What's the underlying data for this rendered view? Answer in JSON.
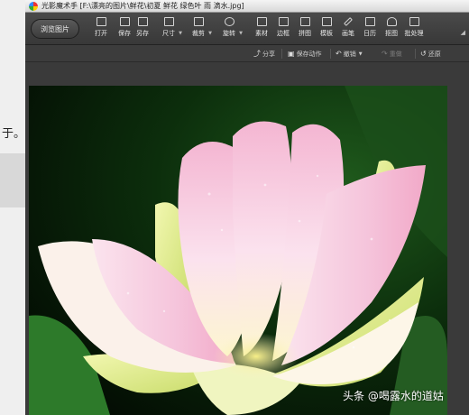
{
  "app": {
    "name": "光影魔术手",
    "file_path": "[F:\\漂亮的图片\\鲜花\\初夏 鲜花 绿色叶 雨 滴水.jpg]"
  },
  "background_doc": {
    "text": "于。"
  },
  "toolbar": {
    "browse_label": "浏览图片",
    "tools": [
      {
        "label": "打开",
        "icon": "folder-open-icon"
      },
      {
        "label": "保存",
        "icon": "save-icon"
      },
      {
        "label": "另存",
        "icon": "save-as-icon"
      },
      {
        "label": "尺寸",
        "icon": "resize-icon"
      },
      {
        "label": "裁剪",
        "icon": "crop-icon"
      },
      {
        "label": "旋转",
        "icon": "rotate-icon"
      },
      {
        "label": "素材",
        "icon": "material-icon"
      },
      {
        "label": "边框",
        "icon": "frame-icon"
      },
      {
        "label": "拼图",
        "icon": "collage-icon"
      },
      {
        "label": "模板",
        "icon": "template-icon"
      },
      {
        "label": "画笔",
        "icon": "brush-icon"
      },
      {
        "label": "日历",
        "icon": "calendar-icon"
      },
      {
        "label": "抠图",
        "icon": "cutout-icon"
      },
      {
        "label": "批处理",
        "icon": "batch-icon"
      }
    ],
    "more": "◢"
  },
  "actions": {
    "share": "分享",
    "save_action": "保存动作",
    "undo": "撤销",
    "redo": "重做",
    "restore": "还原"
  },
  "watermark": "头条 @喝露水的道姑",
  "colors": {
    "toolbar_bg": "#3f3f3f",
    "window_bg": "#3a3a3a"
  }
}
